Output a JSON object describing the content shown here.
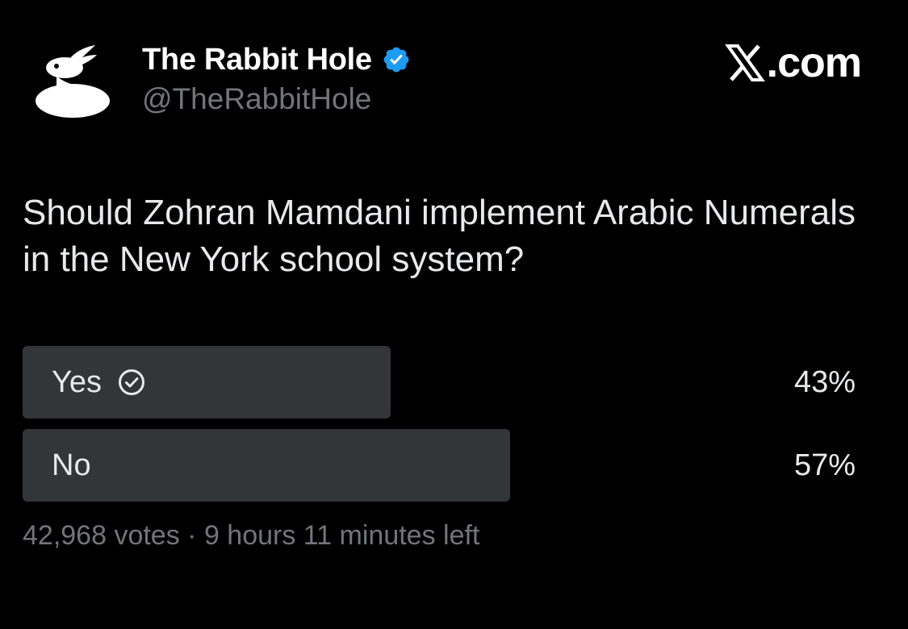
{
  "account": {
    "display_name": "The Rabbit Hole",
    "handle": "@TheRabbitHole",
    "verified": true,
    "avatar_icon": "rabbit-logo-icon",
    "verified_icon": "verified-badge-icon",
    "verified_color": "#1d9bf0"
  },
  "brand": {
    "text": ".com",
    "icon": "x-logo-icon"
  },
  "post": {
    "question": "Should Zohran Mamdani implement Arabic Numerals in the New York school system?"
  },
  "poll": {
    "options": [
      {
        "label": "Yes",
        "percent_label": "43%",
        "percent": 43,
        "selected": true,
        "icon": "check-circle-icon"
      },
      {
        "label": "No",
        "percent_label": "57%",
        "percent": 57,
        "selected": false
      }
    ],
    "votes": "42,968 votes",
    "separator": "·",
    "time_left": "9 hours 11 minutes left"
  },
  "colors": {
    "background": "#000000",
    "bar_fill": "#333639",
    "secondary_text": "#71767b",
    "primary_text": "#e7e9ea"
  }
}
